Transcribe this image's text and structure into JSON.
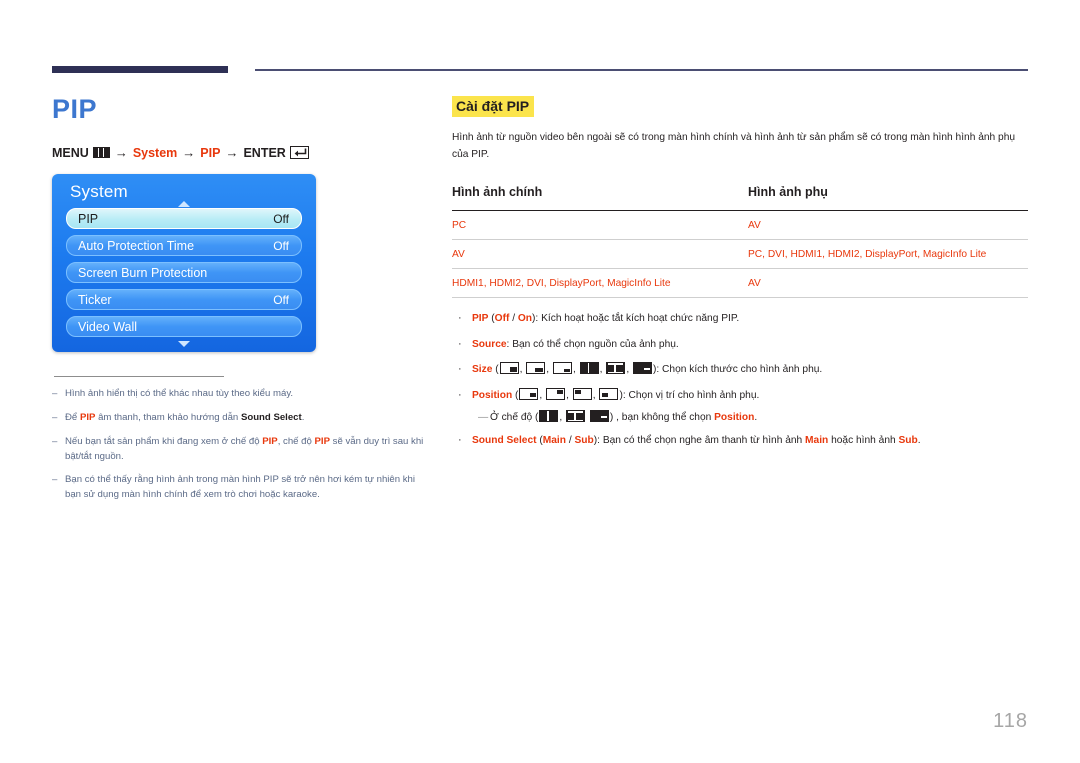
{
  "page": {
    "number": "118",
    "title": "PIP",
    "accent_blue": "#3d77cf",
    "accent_red": "#e8380d",
    "highlight_yellow": "#fbe44c",
    "rule_navy": "#2e3055"
  },
  "menu_path": {
    "menu_label": "MENU",
    "menu_icon": "menu-grid-icon",
    "arrow": "→",
    "step1": "System",
    "step2": "PIP",
    "enter_label": "ENTER",
    "enter_icon": "enter-key-icon"
  },
  "osd": {
    "title": "System",
    "caret_up_icon": "caret-up-icon",
    "caret_down_icon": "caret-down-icon",
    "rows": [
      {
        "label": "PIP",
        "value": "Off",
        "selected": true
      },
      {
        "label": "Auto Protection Time",
        "value": "Off",
        "selected": false
      },
      {
        "label": "Screen Burn Protection",
        "value": "",
        "selected": false
      },
      {
        "label": "Ticker",
        "value": "Off",
        "selected": false
      },
      {
        "label": "Video Wall",
        "value": "",
        "selected": false
      }
    ]
  },
  "left_notes": [
    {
      "dash": "–",
      "parts": [
        {
          "t": "Hình ảnh hiển thị có thể khác nhau tùy theo kiểu máy.",
          "s": "plain"
        }
      ]
    },
    {
      "dash": "–",
      "parts": [
        {
          "t": "Để ",
          "s": "plain"
        },
        {
          "t": "PIP",
          "s": "red-bold"
        },
        {
          "t": " âm thanh, tham khảo hướng dẫn ",
          "s": "plain"
        },
        {
          "t": "Sound Select",
          "s": "dark-bold"
        },
        {
          "t": ".",
          "s": "plain"
        }
      ]
    },
    {
      "dash": "–",
      "parts": [
        {
          "t": "Nếu bạn tắt sản phẩm khi đang xem ở chế độ ",
          "s": "plain"
        },
        {
          "t": "PIP",
          "s": "red-bold"
        },
        {
          "t": ", chế độ ",
          "s": "plain"
        },
        {
          "t": "PIP",
          "s": "red-bold"
        },
        {
          "t": " sẽ vẫn duy trì sau khi bật/tắt nguồn.",
          "s": "plain"
        }
      ]
    },
    {
      "dash": "–",
      "parts": [
        {
          "t": "Bạn có thể thấy rằng hình ảnh trong màn hình PIP sẽ trở nên hơi kém tự nhiên khi bạn sử dụng màn hình chính để xem trò chơi hoặc karaoke.",
          "s": "plain"
        }
      ]
    }
  ],
  "section": {
    "heading": "Cài đặt PIP",
    "intro": "Hình ảnh từ nguồn video bên ngoài sẽ có trong màn hình chính và hình ảnh từ sản phẩm sẽ có trong màn hình hình ảnh phụ của PIP."
  },
  "table": {
    "headers": [
      "Hình ảnh chính",
      "Hình ảnh phụ"
    ],
    "rows": [
      [
        "PC",
        "AV"
      ],
      [
        "AV",
        "PC, DVI, HDMI1, HDMI2, DisplayPort, MagicInfo Lite"
      ],
      [
        "HDMI1, HDMI2, DVI, DisplayPort, MagicInfo Lite",
        "AV"
      ]
    ]
  },
  "bullets": {
    "dot": "·",
    "pip": {
      "name": "PIP",
      "open": " (",
      "opt_off": "Off",
      "slash": " / ",
      "opt_on": "On",
      "close": "): ",
      "desc": "Kích hoạt hoặc tắt kích hoạt chức năng PIP."
    },
    "source": {
      "name": "Source",
      "colon": ": ",
      "desc": "Bạn có thể chọn nguồn của ảnh phụ."
    },
    "size": {
      "name": "Size",
      "open": " (",
      "close": "): ",
      "desc": "Chọn kích thước cho hình ảnh phụ.",
      "icons": [
        "pip-size-large-icon",
        "pip-size-medium-icon",
        "pip-size-small-icon",
        "pip-size-half-split-icon",
        "pip-size-double-wide-icon",
        "pip-size-wide-bar-icon"
      ]
    },
    "position": {
      "name": "Position",
      "open": " (",
      "close": "): ",
      "desc": "Chọn vị trí cho hình ảnh phụ.",
      "icons": [
        "pip-position-bottom-right-icon",
        "pip-position-top-right-icon",
        "pip-position-top-left-icon",
        "pip-position-bottom-left-icon"
      ]
    },
    "position_note": {
      "dash": "—",
      "pre": "Ở chế độ (",
      "mid": ") , ",
      "text": "bạn không thể chọn ",
      "name": "Position",
      "end": ".",
      "icons": [
        "pip-size-half-split-icon",
        "pip-size-double-wide-icon",
        "pip-size-wide-bar-icon"
      ]
    },
    "sound_select": {
      "name": "Sound Select",
      "open": " (",
      "opt_main": "Main",
      "slash": " / ",
      "opt_sub": "Sub",
      "close": "): ",
      "desc_a": "Bạn có thể chọn nghe âm thanh từ hình ảnh ",
      "main": "Main",
      "desc_b": " hoặc hình ảnh ",
      "sub": "Sub",
      "desc_c": "."
    }
  }
}
